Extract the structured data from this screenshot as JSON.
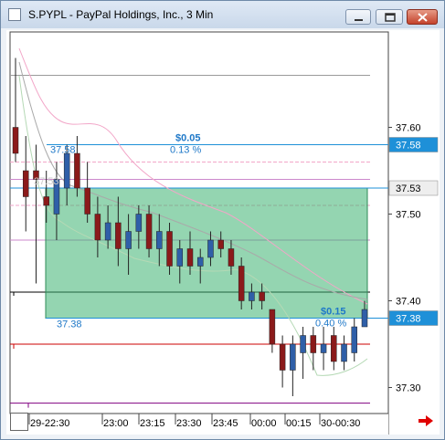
{
  "window": {
    "title": "S.PYPL - PayPal Holdings, Inc., 3 Min",
    "buttons": [
      "minimize",
      "maximize",
      "close"
    ]
  },
  "chart_data": {
    "type": "candlestick",
    "symbol": "S.PYPL",
    "company": "PayPal Holdings, Inc.",
    "interval": "3 Min",
    "ylim": [
      37.27,
      37.71
    ],
    "yticks": [
      37.3,
      37.4,
      37.5,
      37.6
    ],
    "price_tags": [
      {
        "value": 37.58,
        "label": "37.58",
        "bg": "#1e90d8",
        "fg": "#ffffff"
      },
      {
        "value": 37.53,
        "label": "37.53",
        "bg": "#eeeeee",
        "fg": "#000000"
      },
      {
        "value": 37.38,
        "label": "37.38",
        "bg": "#1e90d8",
        "fg": "#ffffff"
      }
    ],
    "x_labels": [
      "29-22:30",
      "23:00",
      "23:15",
      "23:30",
      "23:45",
      "00:00",
      "00:15",
      "30-00:30"
    ],
    "candles": [
      {
        "o": 37.6,
        "h": 37.68,
        "l": 37.56,
        "c": 37.57
      },
      {
        "o": 37.55,
        "h": 37.59,
        "l": 37.48,
        "c": 37.52
      },
      {
        "o": 37.55,
        "h": 37.58,
        "l": 37.42,
        "c": 37.54
      },
      {
        "o": 37.52,
        "h": 37.55,
        "l": 37.49,
        "c": 37.51
      },
      {
        "o": 37.5,
        "h": 37.56,
        "l": 37.47,
        "c": 37.54
      },
      {
        "o": 37.53,
        "h": 37.58,
        "l": 37.51,
        "c": 37.57
      },
      {
        "o": 37.57,
        "h": 37.59,
        "l": 37.52,
        "c": 37.53
      },
      {
        "o": 37.53,
        "h": 37.56,
        "l": 37.49,
        "c": 37.5
      },
      {
        "o": 37.5,
        "h": 37.52,
        "l": 37.45,
        "c": 37.47
      },
      {
        "o": 37.47,
        "h": 37.51,
        "l": 37.46,
        "c": 37.49
      },
      {
        "o": 37.49,
        "h": 37.52,
        "l": 37.44,
        "c": 37.46
      },
      {
        "o": 37.46,
        "h": 37.5,
        "l": 37.43,
        "c": 37.48
      },
      {
        "o": 37.48,
        "h": 37.51,
        "l": 37.46,
        "c": 37.5
      },
      {
        "o": 37.5,
        "h": 37.51,
        "l": 37.45,
        "c": 37.46
      },
      {
        "o": 37.46,
        "h": 37.5,
        "l": 37.44,
        "c": 37.48
      },
      {
        "o": 37.48,
        "h": 37.49,
        "l": 37.43,
        "c": 37.44
      },
      {
        "o": 37.44,
        "h": 37.47,
        "l": 37.42,
        "c": 37.46
      },
      {
        "o": 37.46,
        "h": 37.48,
        "l": 37.43,
        "c": 37.44
      },
      {
        "o": 37.44,
        "h": 37.46,
        "l": 37.42,
        "c": 37.45
      },
      {
        "o": 37.45,
        "h": 37.48,
        "l": 37.44,
        "c": 37.47
      },
      {
        "o": 37.47,
        "h": 37.48,
        "l": 37.45,
        "c": 37.46
      },
      {
        "o": 37.46,
        "h": 37.47,
        "l": 37.43,
        "c": 37.44
      },
      {
        "o": 37.44,
        "h": 37.45,
        "l": 37.39,
        "c": 37.4
      },
      {
        "o": 37.4,
        "h": 37.42,
        "l": 37.39,
        "c": 37.41
      },
      {
        "o": 37.41,
        "h": 37.42,
        "l": 37.39,
        "c": 37.4
      },
      {
        "o": 37.39,
        "h": 37.39,
        "l": 37.34,
        "c": 37.35
      },
      {
        "o": 37.35,
        "h": 37.36,
        "l": 37.3,
        "c": 37.32
      },
      {
        "o": 37.32,
        "h": 37.36,
        "l": 37.29,
        "c": 37.35
      },
      {
        "o": 37.34,
        "h": 37.37,
        "l": 37.31,
        "c": 37.36
      },
      {
        "o": 37.36,
        "h": 37.37,
        "l": 37.32,
        "c": 37.34
      },
      {
        "o": 37.34,
        "h": 37.37,
        "l": 37.32,
        "c": 37.35
      },
      {
        "o": 37.36,
        "h": 37.37,
        "l": 37.32,
        "c": 37.33
      },
      {
        "o": 37.33,
        "h": 37.36,
        "l": 37.32,
        "c": 37.35
      },
      {
        "o": 37.34,
        "h": 37.38,
        "l": 37.33,
        "c": 37.37
      },
      {
        "o": 37.37,
        "h": 37.4,
        "l": 37.37,
        "c": 37.39
      }
    ],
    "colors": {
      "up": "#2f5fa8",
      "down": "#8b1a1a"
    },
    "hlines": [
      {
        "value": 37.66,
        "color": "#9a9a9a"
      },
      {
        "value": 37.56,
        "color": "#f2a6c8",
        "dash": true
      },
      {
        "value": 37.54,
        "color": "#cc88cc"
      },
      {
        "value": 37.51,
        "color": "#f2a6c8",
        "dash": true
      },
      {
        "value": 37.47,
        "color": "#cc88cc"
      },
      {
        "value": 37.41,
        "color": "#000000"
      },
      {
        "value": 37.35,
        "color": "#cc0000"
      },
      {
        "value": 37.282,
        "color": "#800080"
      }
    ],
    "measure_tool": {
      "top_price": 37.53,
      "bottom_price": 37.38,
      "left_label": "37.38",
      "upper_annotation": {
        "change": "$0.05",
        "percent": "0.13 %",
        "level_label": "37.58",
        "ghost_label": "37.53"
      },
      "lower_annotation": {
        "change": "$0.15",
        "percent": "0.40 %"
      }
    }
  }
}
